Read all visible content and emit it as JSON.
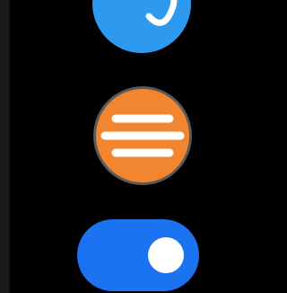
{
  "colors": {
    "background": "#000000",
    "side_strip": "#1b1b1b",
    "blue_button": "#2d9af0",
    "orange_button": "#f28630",
    "orange_button_border": "#5a5a5a",
    "toggle_on": "#1c73f2",
    "foreground": "#ffffff"
  },
  "controls": {
    "top_button_icon": "refresh-arc-icon",
    "menu_button_icon": "hamburger-menu-icon",
    "toggle_state": "on"
  }
}
